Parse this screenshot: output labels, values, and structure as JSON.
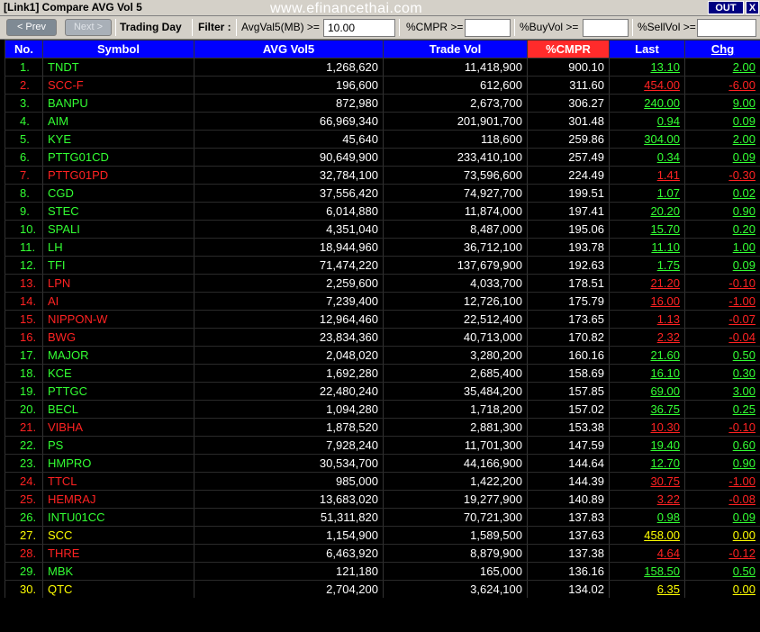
{
  "window": {
    "title": "[Link1] Compare AVG Vol 5",
    "watermark": "www.efinancethai.com",
    "out_label": "OUT",
    "close_label": "X"
  },
  "toolbar": {
    "prev_label": "< Prev",
    "next_label": "Next >",
    "trading_day_label": "Trading Day",
    "filter_label": "Filter :",
    "avgvol_label": "AvgVal5(MB) >=",
    "avgvol_value": "10.00",
    "cmpr_label": "%CMPR >=",
    "cmpr_value": "",
    "buyvol_label": "%BuyVol >=",
    "buyvol_value": "",
    "sellvol_label": "%SellVol >=",
    "sellvol_value": ""
  },
  "table": {
    "headers": [
      "No.",
      "Symbol",
      "AVG Vol5",
      "Trade Vol",
      "%CMPR",
      "Last",
      "Chg"
    ],
    "colors": {
      "up": "#33ff33",
      "down": "#ff2222",
      "flat": "#ffff00",
      "header_bg": "#0000ff",
      "cmpr_header_bg": "#ff2b2b"
    },
    "rows": [
      {
        "no": "1.",
        "symbol": "TNDT",
        "avg": "1,268,620",
        "trade": "11,418,900",
        "cmpr": "900.10",
        "last": "13.10",
        "chg": "2.00",
        "dir": "up"
      },
      {
        "no": "2.",
        "symbol": "SCC-F",
        "avg": "196,600",
        "trade": "612,600",
        "cmpr": "311.60",
        "last": "454.00",
        "chg": "-6.00",
        "dir": "down"
      },
      {
        "no": "3.",
        "symbol": "BANPU",
        "avg": "872,980",
        "trade": "2,673,700",
        "cmpr": "306.27",
        "last": "240.00",
        "chg": "9.00",
        "dir": "up"
      },
      {
        "no": "4.",
        "symbol": "AIM",
        "avg": "66,969,340",
        "trade": "201,901,700",
        "cmpr": "301.48",
        "last": "0.94",
        "chg": "0.09",
        "dir": "up"
      },
      {
        "no": "5.",
        "symbol": "KYE",
        "avg": "45,640",
        "trade": "118,600",
        "cmpr": "259.86",
        "last": "304.00",
        "chg": "2.00",
        "dir": "up"
      },
      {
        "no": "6.",
        "symbol": "PTTG01CD",
        "avg": "90,649,900",
        "trade": "233,410,100",
        "cmpr": "257.49",
        "last": "0.34",
        "chg": "0.09",
        "dir": "up"
      },
      {
        "no": "7.",
        "symbol": "PTTG01PD",
        "avg": "32,784,100",
        "trade": "73,596,600",
        "cmpr": "224.49",
        "last": "1.41",
        "chg": "-0.30",
        "dir": "down"
      },
      {
        "no": "8.",
        "symbol": "CGD",
        "avg": "37,556,420",
        "trade": "74,927,700",
        "cmpr": "199.51",
        "last": "1.07",
        "chg": "0.02",
        "dir": "up"
      },
      {
        "no": "9.",
        "symbol": "STEC",
        "avg": "6,014,880",
        "trade": "11,874,000",
        "cmpr": "197.41",
        "last": "20.20",
        "chg": "0.90",
        "dir": "up"
      },
      {
        "no": "10.",
        "symbol": "SPALI",
        "avg": "4,351,040",
        "trade": "8,487,000",
        "cmpr": "195.06",
        "last": "15.70",
        "chg": "0.20",
        "dir": "up"
      },
      {
        "no": "11.",
        "symbol": "LH",
        "avg": "18,944,960",
        "trade": "36,712,100",
        "cmpr": "193.78",
        "last": "11.10",
        "chg": "1.00",
        "dir": "up"
      },
      {
        "no": "12.",
        "symbol": "TFI",
        "avg": "71,474,220",
        "trade": "137,679,900",
        "cmpr": "192.63",
        "last": "1.75",
        "chg": "0.09",
        "dir": "up"
      },
      {
        "no": "13.",
        "symbol": "LPN",
        "avg": "2,259,600",
        "trade": "4,033,700",
        "cmpr": "178.51",
        "last": "21.20",
        "chg": "-0.10",
        "dir": "down"
      },
      {
        "no": "14.",
        "symbol": "AI",
        "avg": "7,239,400",
        "trade": "12,726,100",
        "cmpr": "175.79",
        "last": "16.00",
        "chg": "-1.00",
        "dir": "down"
      },
      {
        "no": "15.",
        "symbol": "NIPPON-W",
        "avg": "12,964,460",
        "trade": "22,512,400",
        "cmpr": "173.65",
        "last": "1.13",
        "chg": "-0.07",
        "dir": "down"
      },
      {
        "no": "16.",
        "symbol": "BWG",
        "avg": "23,834,360",
        "trade": "40,713,000",
        "cmpr": "170.82",
        "last": "2.32",
        "chg": "-0.04",
        "dir": "down"
      },
      {
        "no": "17.",
        "symbol": "MAJOR",
        "avg": "2,048,020",
        "trade": "3,280,200",
        "cmpr": "160.16",
        "last": "21.60",
        "chg": "0.50",
        "dir": "up"
      },
      {
        "no": "18.",
        "symbol": "KCE",
        "avg": "1,692,280",
        "trade": "2,685,400",
        "cmpr": "158.69",
        "last": "16.10",
        "chg": "0.30",
        "dir": "up"
      },
      {
        "no": "19.",
        "symbol": "PTTGC",
        "avg": "22,480,240",
        "trade": "35,484,200",
        "cmpr": "157.85",
        "last": "69.00",
        "chg": "3.00",
        "dir": "up"
      },
      {
        "no": "20.",
        "symbol": "BECL",
        "avg": "1,094,280",
        "trade": "1,718,200",
        "cmpr": "157.02",
        "last": "36.75",
        "chg": "0.25",
        "dir": "up"
      },
      {
        "no": "21.",
        "symbol": "VIBHA",
        "avg": "1,878,520",
        "trade": "2,881,300",
        "cmpr": "153.38",
        "last": "10.30",
        "chg": "-0.10",
        "dir": "down"
      },
      {
        "no": "22.",
        "symbol": "PS",
        "avg": "7,928,240",
        "trade": "11,701,300",
        "cmpr": "147.59",
        "last": "19.40",
        "chg": "0.60",
        "dir": "up"
      },
      {
        "no": "23.",
        "symbol": "HMPRO",
        "avg": "30,534,700",
        "trade": "44,166,900",
        "cmpr": "144.64",
        "last": "12.70",
        "chg": "0.90",
        "dir": "up"
      },
      {
        "no": "24.",
        "symbol": "TTCL",
        "avg": "985,000",
        "trade": "1,422,200",
        "cmpr": "144.39",
        "last": "30.75",
        "chg": "-1.00",
        "dir": "down"
      },
      {
        "no": "25.",
        "symbol": "HEMRAJ",
        "avg": "13,683,020",
        "trade": "19,277,900",
        "cmpr": "140.89",
        "last": "3.22",
        "chg": "-0.08",
        "dir": "down"
      },
      {
        "no": "26.",
        "symbol": "INTU01CC",
        "avg": "51,311,820",
        "trade": "70,721,300",
        "cmpr": "137.83",
        "last": "0.98",
        "chg": "0.09",
        "dir": "up"
      },
      {
        "no": "27.",
        "symbol": "SCC",
        "avg": "1,154,900",
        "trade": "1,589,500",
        "cmpr": "137.63",
        "last": "458.00",
        "chg": "0.00",
        "dir": "flat"
      },
      {
        "no": "28.",
        "symbol": "THRE",
        "avg": "6,463,920",
        "trade": "8,879,900",
        "cmpr": "137.38",
        "last": "4.64",
        "chg": "-0.12",
        "dir": "down"
      },
      {
        "no": "29.",
        "symbol": "MBK",
        "avg": "121,180",
        "trade": "165,000",
        "cmpr": "136.16",
        "last": "158.50",
        "chg": "0.50",
        "dir": "up"
      },
      {
        "no": "30.",
        "symbol": "QTC",
        "avg": "2,704,200",
        "trade": "3,624,100",
        "cmpr": "134.02",
        "last": "6.35",
        "chg": "0.00",
        "dir": "flat"
      }
    ]
  }
}
